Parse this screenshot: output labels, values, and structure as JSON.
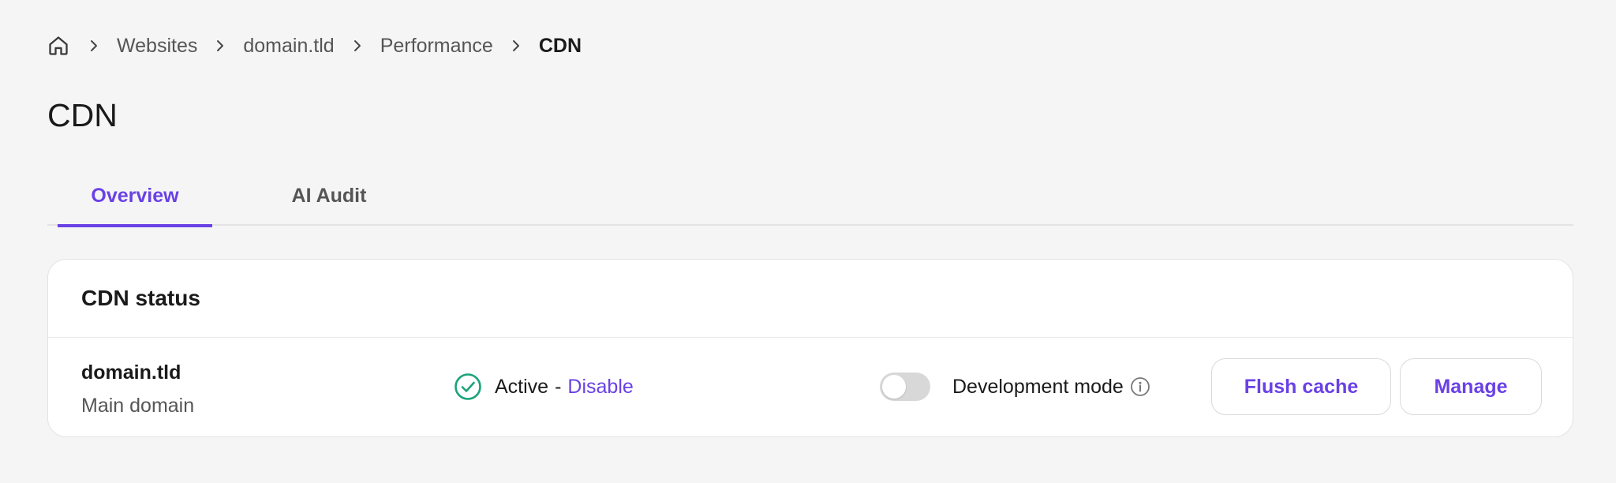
{
  "breadcrumb": {
    "items": [
      "Websites",
      "domain.tld",
      "Performance"
    ],
    "current": "CDN"
  },
  "page": {
    "title": "CDN"
  },
  "tabs": [
    {
      "label": "Overview",
      "active": true
    },
    {
      "label": "AI Audit",
      "active": false
    }
  ],
  "cdn_status": {
    "title": "CDN status",
    "domain": "domain.tld",
    "domain_type": "Main domain",
    "status_text": "Active",
    "status_separator": "-",
    "disable_label": "Disable",
    "dev_mode_label": "Development mode",
    "dev_mode_enabled": false,
    "flush_label": "Flush cache",
    "manage_label": "Manage"
  },
  "colors": {
    "accent": "#6a41e5",
    "success": "#1aa37a",
    "background": "#f5f5f5"
  },
  "icons": {
    "home": "home-icon",
    "breadcrumb_separator": "chevron-right-icon",
    "status": "check-circle-icon",
    "info": "info-icon"
  }
}
